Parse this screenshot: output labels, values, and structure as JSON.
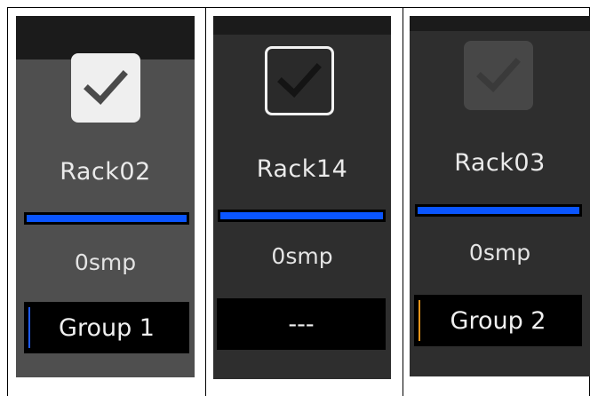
{
  "channels": [
    {
      "name": "Rack02",
      "checkbox_state": "checked",
      "delay": "0smp",
      "group_label": "Group 1",
      "group_color": "#1e5bff",
      "meter_color": "#0a55ff"
    },
    {
      "name": "Rack14",
      "checkbox_state": "checked",
      "delay": "0smp",
      "group_label": "---",
      "group_color": null,
      "meter_color": "#0a55ff"
    },
    {
      "name": "Rack03",
      "checkbox_state": "checked-disabled",
      "delay": "0smp",
      "group_label": "Group 2",
      "group_color": "#e8941a",
      "meter_color": "#0a55ff"
    }
  ],
  "icons": {
    "checkbox": "checkmark-icon"
  }
}
